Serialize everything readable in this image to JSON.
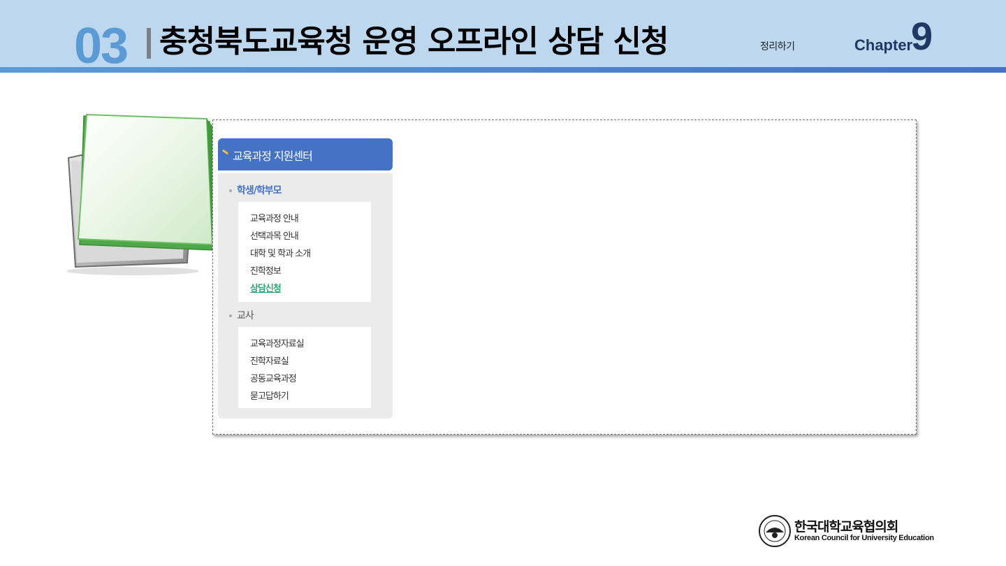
{
  "header": {
    "section_number": "03",
    "title": "충청북도교육청 운영 오프라인 상담 신청",
    "summary_link": "정리하기",
    "chapter_label": "Chapter",
    "chapter_number": "9"
  },
  "sidebar": {
    "header_label": "교육과정 지원센터",
    "groups": [
      {
        "title": "학생/학부모",
        "items": [
          {
            "label": "교육과정 안내"
          },
          {
            "label": "선택과목 안내"
          },
          {
            "label": "대학 및 학과 소개"
          },
          {
            "label": "진학정보"
          },
          {
            "label": "상담신청",
            "active": true
          }
        ]
      },
      {
        "title": "교사",
        "items": [
          {
            "label": "교육과정자료실"
          },
          {
            "label": "진학자료실"
          },
          {
            "label": "공동교육과정"
          },
          {
            "label": "묻고답하기"
          }
        ]
      }
    ]
  },
  "footer": {
    "org_name_ko": "한국대학교육협의회",
    "org_name_en": "Korean Council for University Education"
  },
  "colors": {
    "header_bg": "#bdd7ee",
    "accent_blue": "#4472c4",
    "section_number": "#5b9bd5",
    "chapter": "#1f3864",
    "active_item": "#2ea576"
  }
}
